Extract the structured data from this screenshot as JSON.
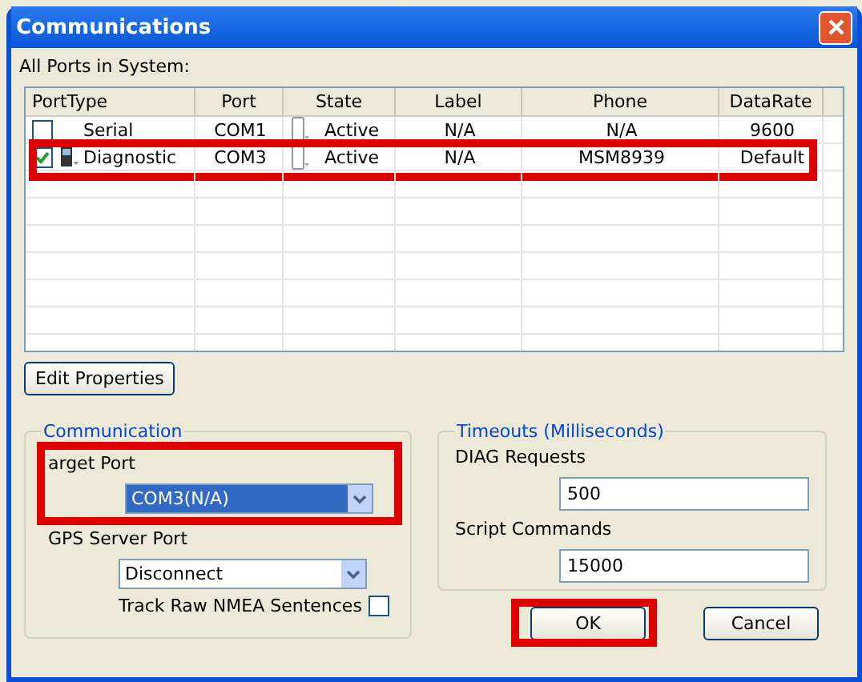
{
  "window": {
    "title": "Communications"
  },
  "ports_label": "All Ports in System:",
  "table": {
    "columns": [
      "PortType",
      "Port",
      "State",
      "Label",
      "Phone",
      "DataRate"
    ],
    "rows": [
      {
        "checked": false,
        "phone_icon": false,
        "highlighted": false,
        "cells": [
          "Serial",
          "COM1",
          "Active",
          "N/A",
          "N/A",
          "9600"
        ]
      },
      {
        "checked": true,
        "phone_icon": true,
        "highlighted": true,
        "cells": [
          "Diagnostic",
          "COM3",
          "Active",
          "N/A",
          "MSM8939",
          "Default"
        ]
      }
    ]
  },
  "edit_button": "Edit Properties",
  "communication": {
    "title": "Communication",
    "target_port": {
      "label": "arget Port",
      "value": "COM3(N/A)",
      "selected": true,
      "highlighted": true
    },
    "gps_port": {
      "label": "GPS Server Port",
      "value": "Disconnect",
      "selected": false
    },
    "track_nmea": {
      "label": "Track Raw NMEA Sentences",
      "checked": false
    }
  },
  "timeouts": {
    "title": "Timeouts (Milliseconds)",
    "fields": [
      {
        "label": "DIAG Requests",
        "value": "500"
      },
      {
        "label": "Script Commands",
        "value": "15000"
      }
    ]
  },
  "buttons": [
    {
      "label": "OK",
      "highlighted": true
    },
    {
      "label": "Cancel",
      "highlighted": false
    }
  ]
}
